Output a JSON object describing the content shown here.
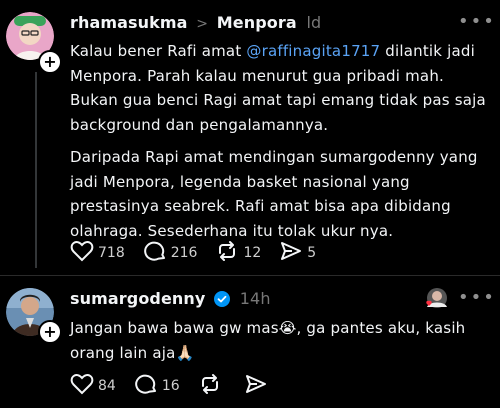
{
  "post1": {
    "username": "rhamasukma",
    "reply_target": "Menpora",
    "time": "ld",
    "paragraph1_pre": "Kalau bener Rafi amat ",
    "mention": "@raffinagita1717",
    "paragraph1_post": " dilantik jadi Menpora. Parah kalau menurut gua pribadi mah. Bukan gua benci Ragi amat tapi emang tidak pas saja background dan pengalamannya.",
    "paragraph2": "Daripada Rapi amat mendingan sumargodenny yang jadi Menpora, legenda basket nasional yang prestasinya seabrek. Rafi amat bisa apa dibidang olahraga. Sesederhana itu tolak ukur nya.",
    "likes": "718",
    "replies": "216",
    "reposts": "12",
    "shares": "5"
  },
  "post2": {
    "username": "sumargodenny",
    "time": "14h",
    "text": "Jangan bawa bawa gw mas😭, ga pantes aku, kasih orang lain aja🙏🏻",
    "likes": "84",
    "replies": "16"
  },
  "icons": {
    "like": "heart-icon",
    "reply": "comment-icon",
    "repost": "repost-icon",
    "share": "send-icon",
    "more": "more-icon",
    "verified": "verified-badge-icon",
    "chevron": "chevron-right-icon"
  },
  "colors": {
    "background": "#000000",
    "mention": "#5aa3f5",
    "verified": "#0095f6",
    "muted": "#777777"
  }
}
